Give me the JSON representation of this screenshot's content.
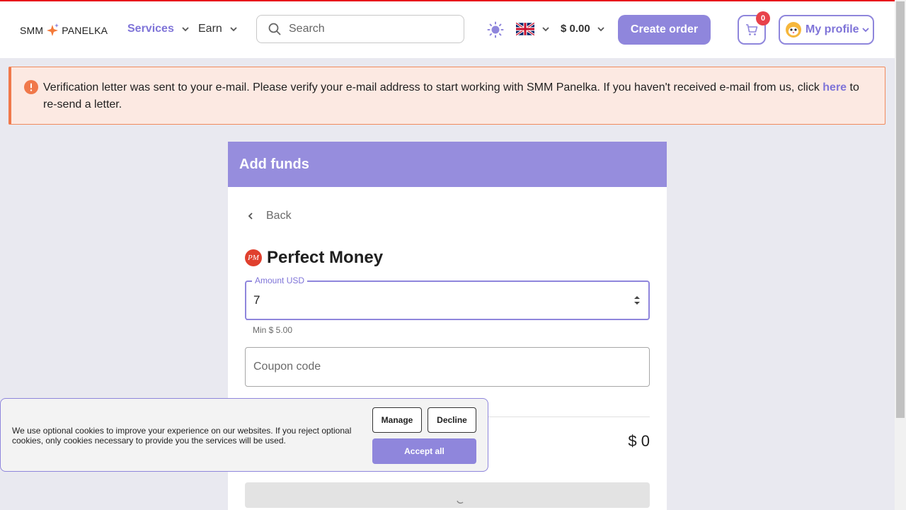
{
  "header": {
    "logo_left": "SMM",
    "logo_right": "PANELKA",
    "nav": [
      {
        "label": "Services"
      },
      {
        "label": "Earn"
      }
    ],
    "search_placeholder": "Search",
    "balance": "$ 0.00",
    "create_order_label": "Create order",
    "cart_count": "0",
    "profile_label": "My profile"
  },
  "alert": {
    "message": "Verification letter was sent to your e-mail. Please verify your e-mail address to start working with SMM Panelka. If you haven't received e-mail from us, click ",
    "link_text": "here",
    "message_end": " to re-send a letter."
  },
  "card": {
    "title": "Add funds",
    "back_label": "Back",
    "method_badge": "PM",
    "method_name": "Perfect Money",
    "amount_label": "Amount USD",
    "amount_value": "7",
    "amount_hint": "Min $ 5.00",
    "coupon_placeholder": "Coupon code",
    "total": "$ 0"
  },
  "cookie": {
    "text": "We use optional cookies to improve your experience on our websites. If you reject optional cookies, only cookies necessary to provide you the services will be used.",
    "manage_label": "Manage",
    "decline_label": "Decline",
    "accept_label": "Accept all"
  },
  "colors": {
    "accent": "#8f86dc",
    "alert_border": "#f0784a",
    "badge": "#e8414a",
    "top_line": "#e8141b"
  }
}
